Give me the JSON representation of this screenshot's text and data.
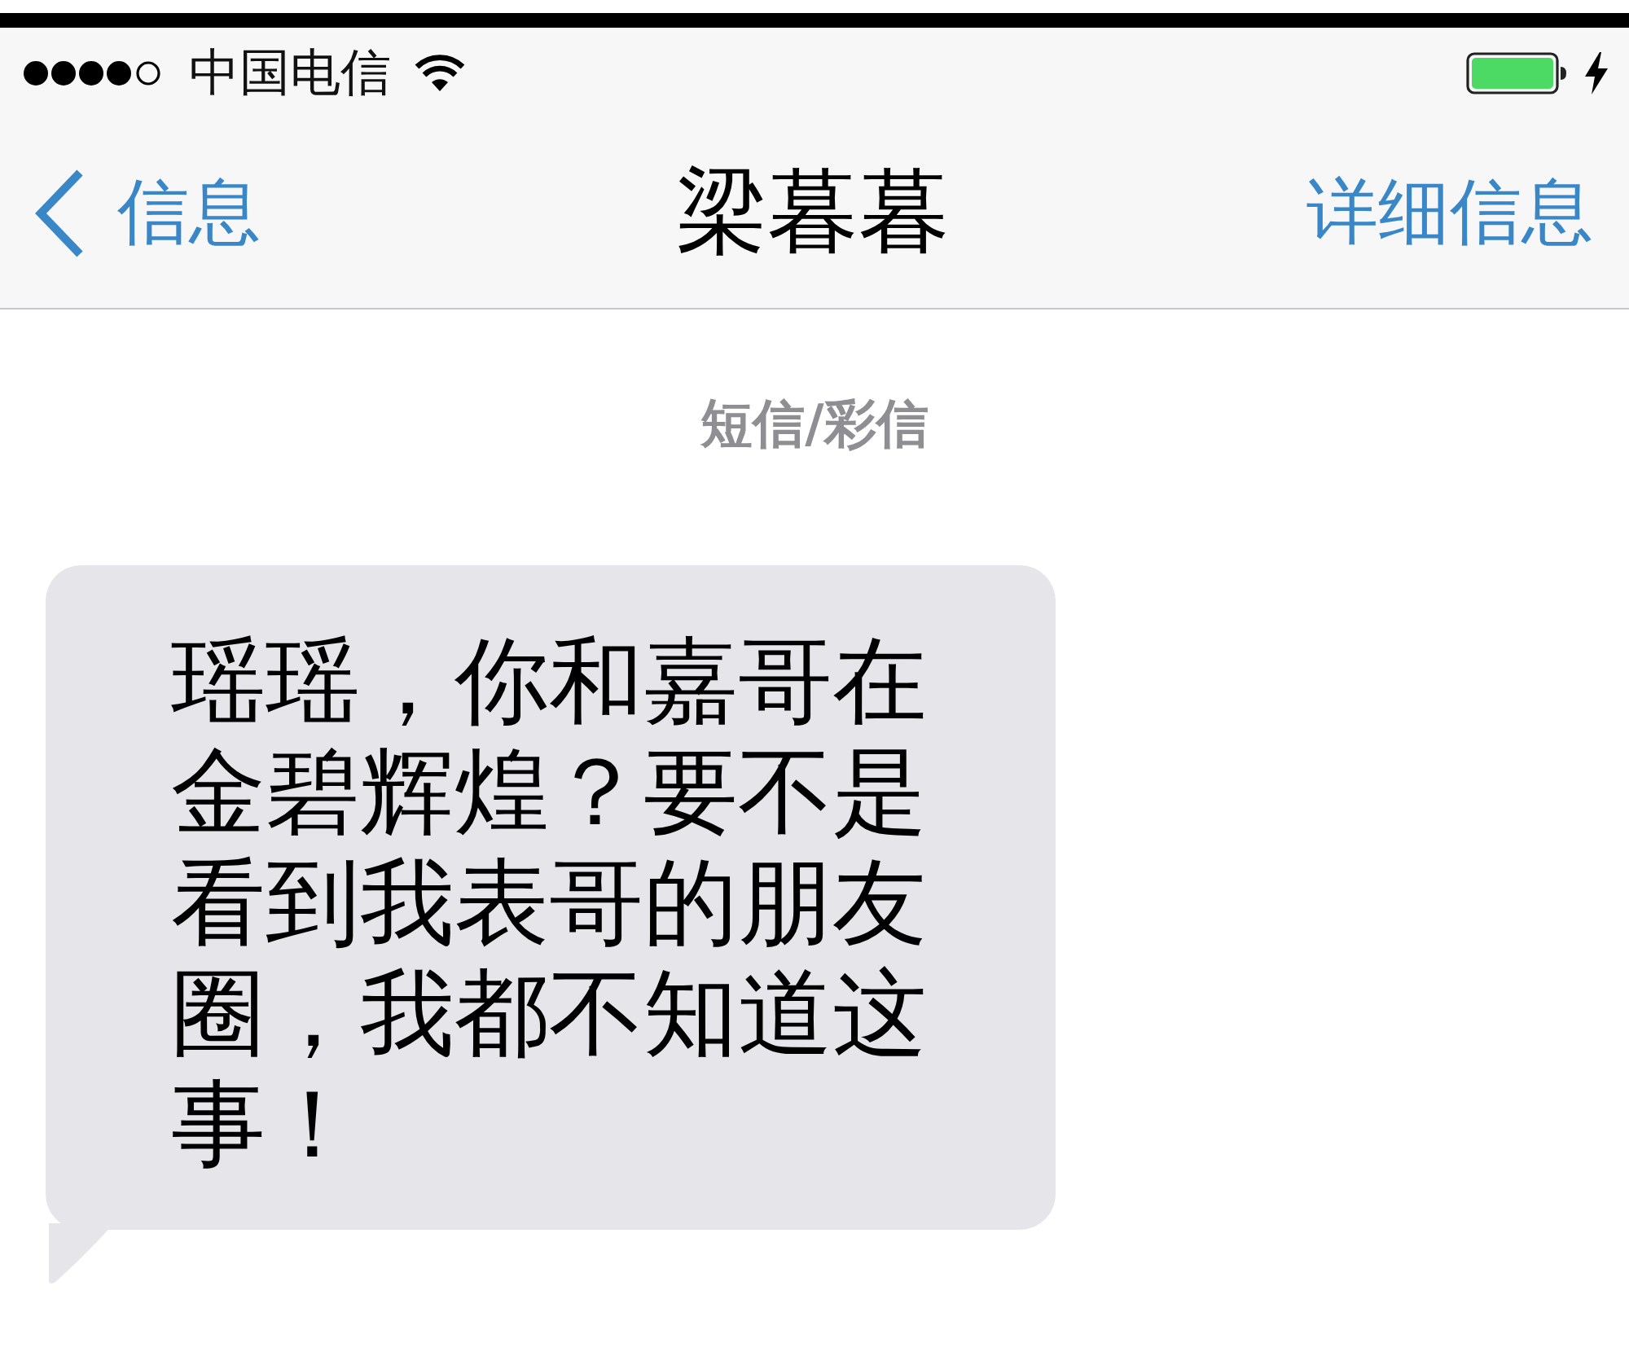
{
  "status_bar": {
    "carrier": "中国电信"
  },
  "nav_bar": {
    "back": "信息",
    "title": "梁暮暮",
    "action": "详细信息"
  },
  "conversation": {
    "service_label": "短信/彩信",
    "messages": [
      {
        "kind": "received",
        "text": "瑶瑶，你和嘉哥在金碧辉煌？要不是看到我表哥的朋友圈，我都不知道这事！"
      }
    ]
  }
}
